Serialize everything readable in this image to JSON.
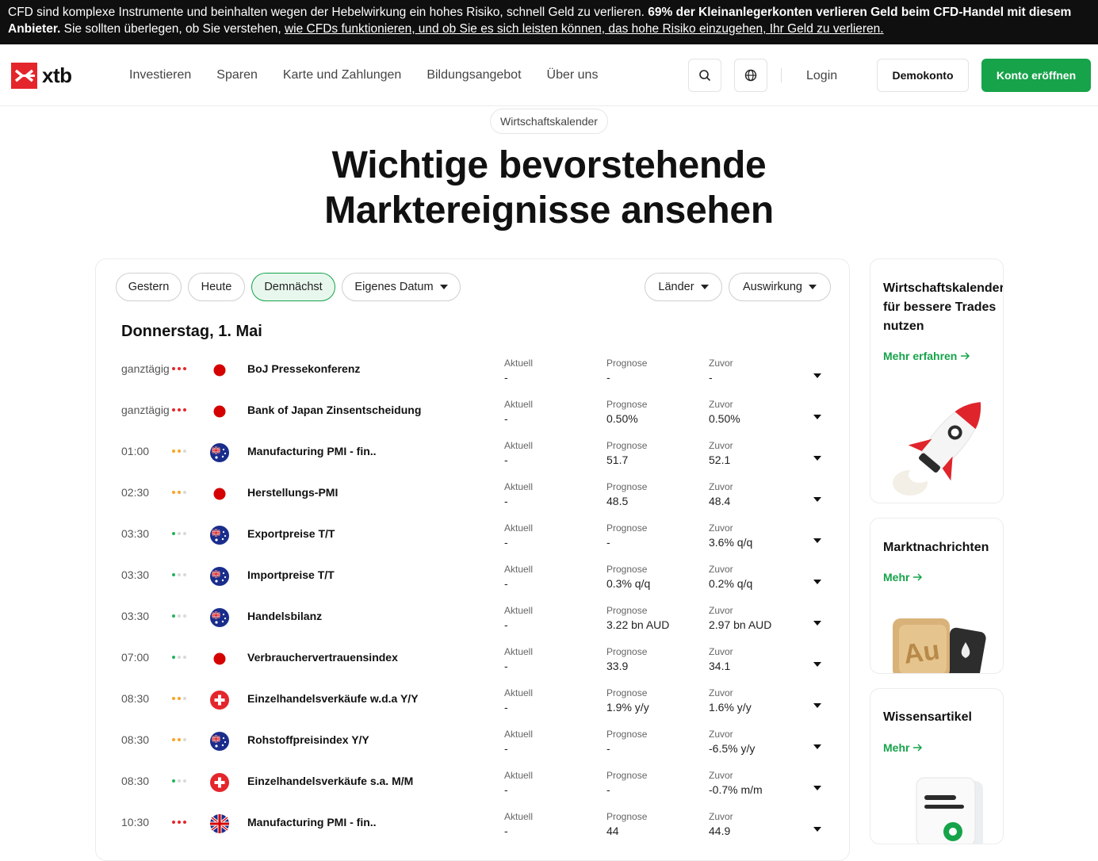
{
  "risk_banner": {
    "text_a": "CFD sind komplexe Instrumente und beinhalten wegen der Hebelwirkung ein hohes Risiko, schnell Geld zu verlieren. ",
    "text_bold": "69% der Kleinanlegerkonten verlieren Geld beim CFD-Handel mit diesem Anbieter.",
    "text_b": " Sie sollten überlegen, ob Sie verstehen, ",
    "link": "wie CFDs funktionieren, und ob Sie es sich leisten können, das hohe Risiko einzugehen, Ihr Geld zu verlieren."
  },
  "header": {
    "logo_text": "xtb",
    "nav": [
      "Investieren",
      "Sparen",
      "Karte und Zahlungen",
      "Bildungsangebot",
      "Über uns"
    ],
    "login": "Login",
    "demo": "Demokonto",
    "open_account": "Konto eröffnen"
  },
  "hero": {
    "pill": "Wirtschaftskalender",
    "title_line1": "Wichtige bevorstehende",
    "title_line2": "Marktereignisse ansehen"
  },
  "filters": {
    "yesterday": "Gestern",
    "today": "Heute",
    "upcoming": "Demnächst",
    "custom_date": "Eigenes Datum",
    "countries": "Länder",
    "impact": "Auswirkung"
  },
  "colors": {
    "accent": "#16a34a",
    "high": "#e4262c",
    "medium": "#f5a623",
    "low": "#22b45a",
    "inactive": "#d9d9d9"
  },
  "calendar": {
    "day_title": "Donnerstag, 1. Mai",
    "col_actual": "Aktuell",
    "col_forecast": "Prognose",
    "col_previous": "Zuvor",
    "events": [
      {
        "time": "ganztägig",
        "impact": 3,
        "flag": "japan-flag-icon",
        "name": "BoJ Pressekonferenz",
        "actual": "-",
        "forecast": "-",
        "previous": "-"
      },
      {
        "time": "ganztägig",
        "impact": 3,
        "flag": "japan-flag-icon",
        "name": "Bank of Japan Zinsentscheidung",
        "actual": "-",
        "forecast": "0.50%",
        "previous": "0.50%"
      },
      {
        "time": "01:00",
        "impact": 2,
        "flag": "australia-flag-icon",
        "name": "Manufacturing PMI - fin..",
        "actual": "-",
        "forecast": "51.7",
        "previous": "52.1"
      },
      {
        "time": "02:30",
        "impact": 2,
        "flag": "japan-flag-icon",
        "name": "Herstellungs-PMI",
        "actual": "-",
        "forecast": "48.5",
        "previous": "48.4"
      },
      {
        "time": "03:30",
        "impact": 1,
        "flag": "australia-flag-icon",
        "name": "Exportpreise T/T",
        "actual": "-",
        "forecast": "-",
        "previous": "3.6% q/q"
      },
      {
        "time": "03:30",
        "impact": 1,
        "flag": "australia-flag-icon",
        "name": "Importpreise T/T",
        "actual": "-",
        "forecast": "0.3% q/q",
        "previous": "0.2% q/q"
      },
      {
        "time": "03:30",
        "impact": 1,
        "flag": "australia-flag-icon",
        "name": "Handelsbilanz",
        "actual": "-",
        "forecast": "3.22 bn AUD",
        "previous": "2.97 bn AUD"
      },
      {
        "time": "07:00",
        "impact": 1,
        "flag": "japan-flag-icon",
        "name": "Verbrauchervertrauensindex",
        "actual": "-",
        "forecast": "33.9",
        "previous": "34.1"
      },
      {
        "time": "08:30",
        "impact": 2,
        "flag": "switzerland-flag-icon",
        "name": "Einzelhandelsverkäufe w.d.a Y/Y",
        "actual": "-",
        "forecast": "1.9% y/y",
        "previous": "1.6% y/y"
      },
      {
        "time": "08:30",
        "impact": 2,
        "flag": "australia-flag-icon",
        "name": "Rohstoffpreisindex Y/Y",
        "actual": "-",
        "forecast": "-",
        "previous": "-6.5% y/y"
      },
      {
        "time": "08:30",
        "impact": 1,
        "flag": "switzerland-flag-icon",
        "name": "Einzelhandelsverkäufe s.a. M/M",
        "actual": "-",
        "forecast": "-",
        "previous": "-0.7% m/m"
      },
      {
        "time": "10:30",
        "impact": 3,
        "flag": "uk-flag-icon",
        "name": "Manufacturing PMI - fin..",
        "actual": "-",
        "forecast": "44",
        "previous": "44.9"
      }
    ]
  },
  "sidebar": {
    "card1": {
      "title_l1": "Wirtschaftskalender",
      "title_l2": "für bessere Trades",
      "title_l3": "nutzen",
      "link": "Mehr erfahren"
    },
    "card2": {
      "title": "Marktnachrichten",
      "link": "Mehr",
      "badge": "Au"
    },
    "card3": {
      "title": "Wissensartikel",
      "link": "Mehr"
    }
  }
}
